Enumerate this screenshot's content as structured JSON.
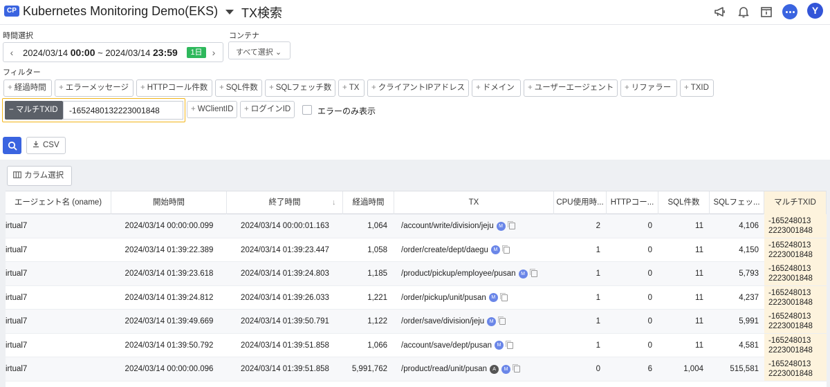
{
  "header": {
    "badge": "CP",
    "project": "Kubernetes Monitoring Demo(EKS)",
    "title": "TX検索",
    "avatar": "Y"
  },
  "time": {
    "label": "時間選択",
    "start_date": "2024/03/14 ",
    "start_time": "00:00",
    "sep": " ~ ",
    "end_date": "2024/03/14 ",
    "end_time": "23:59",
    "range_badge": "1日"
  },
  "container": {
    "label": "コンテナ",
    "value": "すべて選択 ⌄"
  },
  "filters": {
    "label": "フィルター",
    "chips": [
      "経過時間",
      "エラーメッセージ",
      "HTTPコール件数",
      "SQL件数",
      "SQLフェッチ数",
      "TX",
      "クライアントIPアドレス",
      "ドメイン",
      "ユーザーエージェント",
      "リファラー",
      "TXID"
    ],
    "row2_chips": [
      "WClientID",
      "ログインID"
    ],
    "active": {
      "label": "− マルチTXID",
      "value": "-1652480132223001848"
    },
    "errors_only": "エラーのみ表示"
  },
  "actions": {
    "csv": "CSV",
    "column_select": "カラム選択"
  },
  "table": {
    "columns": [
      "エージェント名 (oname)",
      "開始時間",
      "終了時間",
      "経過時間",
      "TX",
      "CPU使用時...",
      "HTTPコー...",
      "SQL件数",
      "SQLフェッ...",
      "マルチTXID"
    ],
    "rows": [
      {
        "agent": "irtual7",
        "start": "2024/03/14 00:00:00.099",
        "end": "2024/03/14 00:00:01.163",
        "elapsed": "1,064",
        "tx": "/account/write/division/jeju",
        "cpu": "2",
        "http": "0",
        "sql": "11",
        "fetch": "4,106",
        "mtx1": "-165248013",
        "mtx2": "2223001848",
        "badges": [
          "M"
        ]
      },
      {
        "agent": "irtual7",
        "start": "2024/03/14 01:39:22.389",
        "end": "2024/03/14 01:39:23.447",
        "elapsed": "1,058",
        "tx": "/order/create/dept/daegu",
        "cpu": "1",
        "http": "0",
        "sql": "11",
        "fetch": "4,150",
        "mtx1": "-165248013",
        "mtx2": "2223001848",
        "badges": [
          "M"
        ]
      },
      {
        "agent": "irtual7",
        "start": "2024/03/14 01:39:23.618",
        "end": "2024/03/14 01:39:24.803",
        "elapsed": "1,185",
        "tx": "/product/pickup/employee/pusan",
        "cpu": "1",
        "http": "0",
        "sql": "11",
        "fetch": "5,793",
        "mtx1": "-165248013",
        "mtx2": "2223001848",
        "badges": [
          "M"
        ]
      },
      {
        "agent": "irtual7",
        "start": "2024/03/14 01:39:24.812",
        "end": "2024/03/14 01:39:26.033",
        "elapsed": "1,221",
        "tx": "/order/pickup/unit/pusan",
        "cpu": "1",
        "http": "0",
        "sql": "11",
        "fetch": "4,237",
        "mtx1": "-165248013",
        "mtx2": "2223001848",
        "badges": [
          "M"
        ]
      },
      {
        "agent": "irtual7",
        "start": "2024/03/14 01:39:49.669",
        "end": "2024/03/14 01:39:50.791",
        "elapsed": "1,122",
        "tx": "/order/save/division/jeju",
        "cpu": "1",
        "http": "0",
        "sql": "11",
        "fetch": "5,991",
        "mtx1": "-165248013",
        "mtx2": "2223001848",
        "badges": [
          "M"
        ]
      },
      {
        "agent": "irtual7",
        "start": "2024/03/14 01:39:50.792",
        "end": "2024/03/14 01:39:51.858",
        "elapsed": "1,066",
        "tx": "/account/save/dept/pusan",
        "cpu": "1",
        "http": "0",
        "sql": "11",
        "fetch": "4,581",
        "mtx1": "-165248013",
        "mtx2": "2223001848",
        "badges": [
          "M"
        ]
      },
      {
        "agent": "irtual7",
        "start": "2024/03/14 00:00:00.096",
        "end": "2024/03/14 01:39:51.858",
        "elapsed": "5,991,762",
        "tx": "/product/read/unit/pusan",
        "cpu": "0",
        "http": "6",
        "sql": "1,004",
        "fetch": "515,581",
        "mtx1": "-165248013",
        "mtx2": "2223001848",
        "badges": [
          "A",
          "M"
        ]
      }
    ]
  },
  "colors": {
    "accent": "#3a64e0",
    "highlight": "#fdf3dd",
    "active_border": "#f2b418",
    "range_badge": "#2eb85c"
  }
}
